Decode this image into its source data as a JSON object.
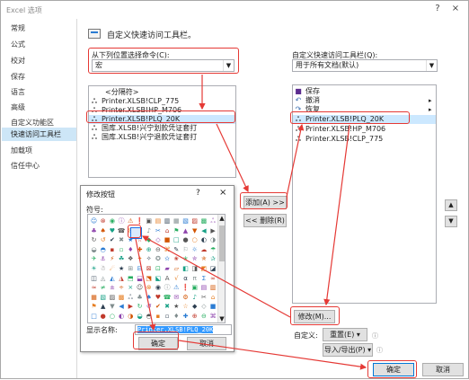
{
  "window": {
    "title": "Excel 选项",
    "help": "?",
    "close": "×"
  },
  "sidebar": {
    "items": [
      {
        "label": "常规"
      },
      {
        "label": "公式"
      },
      {
        "label": "校对"
      },
      {
        "label": "保存"
      },
      {
        "label": "语言"
      },
      {
        "label": "高级"
      },
      {
        "label": "自定义功能区"
      },
      {
        "label": "快速访问工具栏",
        "selected": true
      },
      {
        "label": "加载项"
      },
      {
        "label": "信任中心"
      }
    ]
  },
  "main": {
    "header": "自定义快速访问工具栏。",
    "left_label": "从下列位置选择命令(C):",
    "left_combo": "宏",
    "left_list": [
      {
        "label": "<分隔符>",
        "icon": ""
      },
      {
        "label": "Printer.XLSB!CLP_775",
        "icon": "macro-icon"
      },
      {
        "label": "Printer.XLSB!HP_M706",
        "icon": "macro-icon"
      },
      {
        "label": "Printer.XLSB!PLQ_20K",
        "icon": "macro-icon",
        "selected": true
      },
      {
        "label": "国库.XLSB!兴宁划款凭证套打",
        "icon": "macro-icon"
      },
      {
        "label": "国库.XLSB!兴宁退款凭证套打",
        "icon": "macro-icon"
      }
    ],
    "right_label": "自定义快速访问工具栏(Q):",
    "right_combo": "用于所有文档(默认)",
    "right_list": [
      {
        "label": "保存",
        "icon": "save-icon"
      },
      {
        "label": "撤消",
        "icon": "undo-icon"
      },
      {
        "label": "恢复",
        "icon": "redo-icon"
      },
      {
        "label": "Printer.XLSB!PLQ_20K",
        "icon": "macro-icon",
        "selected": true
      },
      {
        "label": "Printer.XLSB!HP_M706",
        "icon": "macro-icon"
      },
      {
        "label": "Printer.XLSB!CLP_775",
        "icon": "macro-icon"
      }
    ],
    "add_button": "添加(A) >>",
    "remove_button": "<< 删除(R)",
    "modify_button": "修改(M)...",
    "customize_label": "自定义:",
    "reset_button": "重置(E) ▾",
    "import_export_button": "导入/导出(P) ▾",
    "ok_button": "确定",
    "cancel_button": "取消"
  },
  "modify_dialog": {
    "title": "修改按钮",
    "help": "?",
    "close": "×",
    "symbols_label": "符号:",
    "display_name_label": "显示名称:",
    "display_name_value": "Printer.XLSB!PLQ_20K",
    "ok_button": "确定",
    "cancel_button": "取消"
  },
  "colors": {
    "selection": "#cce8ff",
    "sidebar_selection": "#cde6f7",
    "highlight": "#e53935",
    "button_face": "#e1e1e1"
  }
}
